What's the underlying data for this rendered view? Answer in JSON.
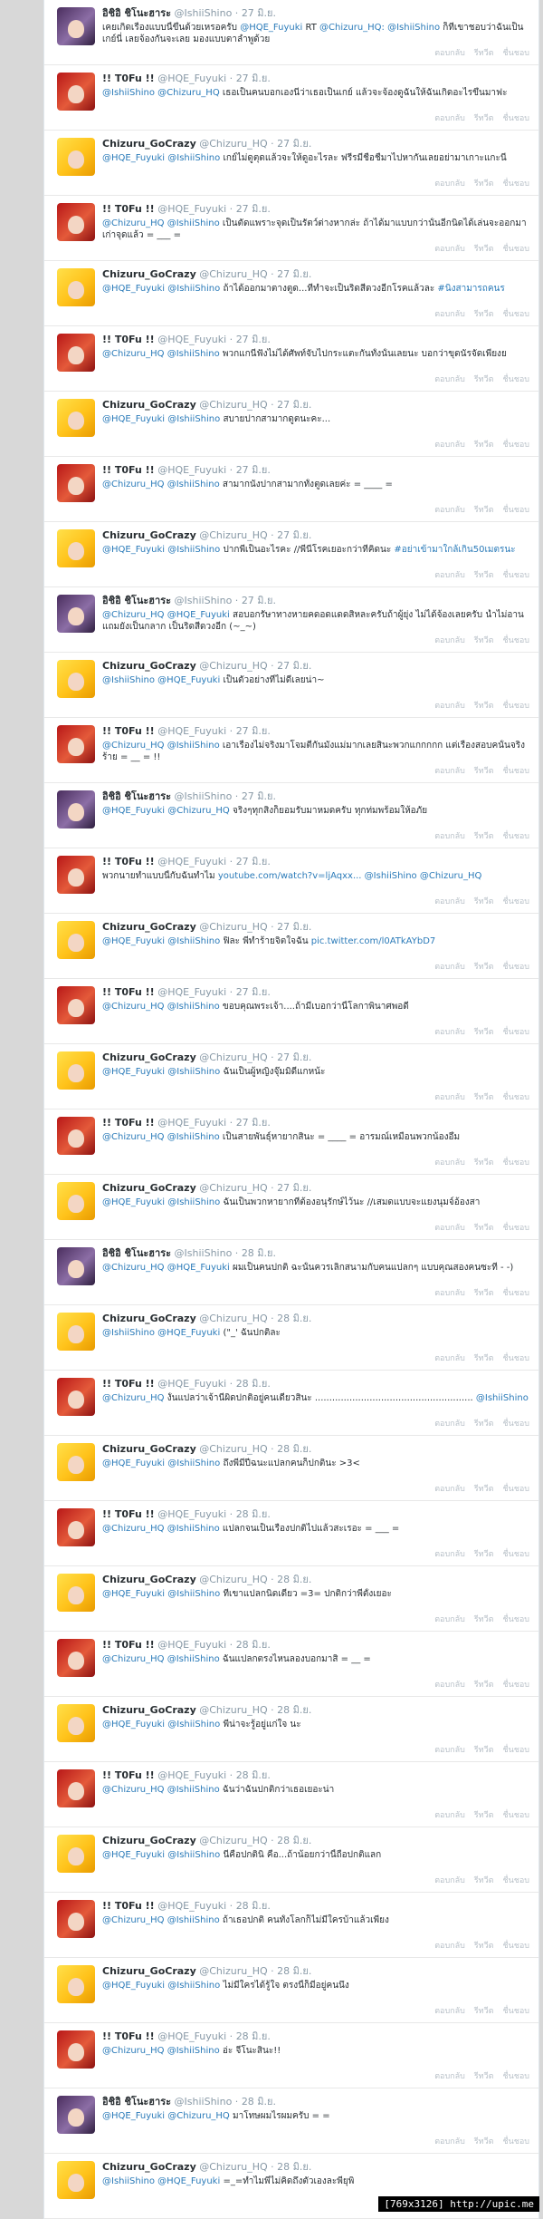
{
  "tweets": [
    {
      "avatar": "purple",
      "name": "อิชิอิ ชิโนะฮาระ",
      "handle": "@IshiiShino",
      "time": "27 มิ.ย.",
      "text": "เคยเกิดเรื่องแบบนี้ขึ้นด้วยเหรอครับ @HQE_Fuyuki RT @Chizuru_HQ: @IshiiShino ก็ที่เขาชอบว่าฉันเป็นเกย์นี่ เลยจ้องกันจะเลย มองแบบตาลำพูด้วย"
    },
    {
      "avatar": "red",
      "name": "!! T0Fu !!",
      "handle": "@HQE_Fuyuki",
      "time": "27 มิ.ย.",
      "text": "@IshiiShino @Chizuru_HQ เธอเป็นคนบอกเองนี่ว่าเธอเป็นเกย์ แล้วจะจ้องดูฉันให้ฉันเกิดอะไรขึ้นมาฟะ"
    },
    {
      "avatar": "yellow",
      "name": "Chizuru_GoCrazy",
      "handle": "@Chizuru_HQ",
      "time": "27 มิ.ย.",
      "text": "@HQE_Fuyuki @IshiiShino เกย์ไม่ดูตุดแล้วจะให้ดูอะไรละ ฟรีรมีชื่อชื่มาไปหากันเลยอย่ามาเกาะแกะนี่"
    },
    {
      "avatar": "red",
      "name": "!! T0Fu !!",
      "handle": "@HQE_Fuyuki",
      "time": "27 มิ.ย.",
      "text": "@Chizuru_HQ @IshiiShino เป็นตัดแพราะจุดเป็นรัตว์ต่างหากล่ะ ถ้าได้มาแบบกว่านั้นอีกนิดได้เล่นจะออกมาเก่าจุดแล้ว = ___ ="
    },
    {
      "avatar": "yellow",
      "name": "Chizuru_GoCrazy",
      "handle": "@Chizuru_HQ",
      "time": "27 มิ.ย.",
      "text": "@HQE_Fuyuki @IshiiShino ถ้าได้ออกมาตางตูด...ที่ทำจะเป็นริดสีดวงอีกโรคแล้วละ #นิ่งสามารถคนร"
    },
    {
      "avatar": "red",
      "name": "!! T0Fu !!",
      "handle": "@HQE_Fuyuki",
      "time": "27 มิ.ย.",
      "text": "@Chizuru_HQ @IshiiShino พวกแกนี่ฟังไม่ได้ศัพท์จับไปกระแตะกันทั้งนั้นเลยนะ บอกว่าขุดนัรจัดเพียงย"
    },
    {
      "avatar": "yellow",
      "name": "Chizuru_GoCrazy",
      "handle": "@Chizuru_HQ",
      "time": "27 มิ.ย.",
      "text": "@HQE_Fuyuki @IshiiShino สบายปากสามากดูตนะคะ..."
    },
    {
      "avatar": "red",
      "name": "!! T0Fu !!",
      "handle": "@HQE_Fuyuki",
      "time": "27 มิ.ย.",
      "text": "@Chizuru_HQ @IshiiShino สามากนังปากสามากทั้งตูดเลยค่ะ = ____ ="
    },
    {
      "avatar": "yellow",
      "name": "Chizuru_GoCrazy",
      "handle": "@Chizuru_HQ",
      "time": "27 มิ.ย.",
      "text": "@HQE_Fuyuki @IshiiShino ปากพี่เป็นอะไรคะ //พี่นี่โรคเยอะกว่าที่คิดนะ #อย่าเข้ามาใกล้เกิน50เมตรนะ"
    },
    {
      "avatar": "purple",
      "name": "อิชิอิ ชิโนะฮาระ",
      "handle": "@IshiiShino",
      "time": "27 มิ.ย.",
      "text": "@Chizuru_HQ @HQE_Fuyuki สอบอกรัษาทางหายคดอดแดดสิหละครับถ้าผู้ยุ่ง ไม่ได้จ้องเลยครับ น้ำไม่อาน แถมยังเป็นกลาก เป็นริดสีดวงอีก (~_~)"
    },
    {
      "avatar": "yellow",
      "name": "Chizuru_GoCrazy",
      "handle": "@Chizuru_HQ",
      "time": "27 มิ.ย.",
      "text": "@IshiiShino @HQE_Fuyuki เป็นตัวอย่างที่ไม่ดีเลยน่า~"
    },
    {
      "avatar": "red",
      "name": "!! T0Fu !!",
      "handle": "@HQE_Fuyuki",
      "time": "27 มิ.ย.",
      "text": "@Chizuru_HQ @IshiiShino เอาเรื่องไม่จริงมาโจมตีกันมั่งแม่มากเลยสินะพวกแกกกกก แต่เรื่องสอบคนั้นจริงร้าย = __ = !!"
    },
    {
      "avatar": "purple",
      "name": "อิชิอิ ชิโนะฮาระ",
      "handle": "@IshiiShino",
      "time": "27 มิ.ย.",
      "text": "@HQE_Fuyuki @Chizuru_HQ จริงๆทุกสิ่งก็ยอมรับมาหมดครับ ทุกท่มพร้อมให้อภัย"
    },
    {
      "avatar": "red",
      "name": "!! T0Fu !!",
      "handle": "@HQE_Fuyuki",
      "time": "27 มิ.ย.",
      "text": "พวกนายทำแบบนี้กับฉันทำไม youtube.com/watch?v=ljAqxx... @IshiiShino @Chizuru_HQ"
    },
    {
      "avatar": "yellow",
      "name": "Chizuru_GoCrazy",
      "handle": "@Chizuru_HQ",
      "time": "27 มิ.ย.",
      "text": "@HQE_Fuyuki @IshiiShino ฟิละ พี่ทำร้ายจิตใจฉัน pic.twitter.com/l0ATkAYbD7"
    },
    {
      "avatar": "red",
      "name": "!! T0Fu !!",
      "handle": "@HQE_Fuyuki",
      "time": "27 มิ.ย.",
      "text": "@Chizuru_HQ @IshiiShino ขอบคุณพระเจ้า....ถ้ามีเบอกว่านี้โลกาพินาศพอดี"
    },
    {
      "avatar": "yellow",
      "name": "Chizuru_GoCrazy",
      "handle": "@Chizuru_HQ",
      "time": "27 มิ.ย.",
      "text": "@HQE_Fuyuki @IshiiShino ฉันเป็นผู้หญิงจุ๊มมิดีแกหน้ะ"
    },
    {
      "avatar": "red",
      "name": "!! T0Fu !!",
      "handle": "@HQE_Fuyuki",
      "time": "27 มิ.ย.",
      "text": "@Chizuru_HQ @IshiiShino เป็นสายพันธุ์หายากสินะ = ____ = อารมณ์เหมือนพวกน้องอึ้ม"
    },
    {
      "avatar": "yellow",
      "name": "Chizuru_GoCrazy",
      "handle": "@Chizuru_HQ",
      "time": "27 มิ.ย.",
      "text": "@HQE_Fuyuki @IshiiShino ฉันเป็นพวกหายากที่ต้องอนุรักษ์ไว้นะ //เสมดแบบจะแยงนุมจ์อ้องสา"
    },
    {
      "avatar": "purple",
      "name": "อิชิอิ ชิโนะฮาระ",
      "handle": "@IshiiShino",
      "time": "28 มิ.ย.",
      "text": "@Chizuru_HQ @HQE_Fuyuki ผมเป็นคนปกติ ฉะนั้นควรเลิกสนามกับคนแปลกๆ แบบคุณสองคนซะที - -)"
    },
    {
      "avatar": "yellow",
      "name": "Chizuru_GoCrazy",
      "handle": "@Chizuru_HQ",
      "time": "28 มิ.ย.",
      "text": "@IshiiShino @HQE_Fuyuki (\"_' ฉันปกติละ"
    },
    {
      "avatar": "red",
      "name": "!! T0Fu !!",
      "handle": "@HQE_Fuyuki",
      "time": "28 มิ.ย.",
      "text": "@Chizuru_HQ งั้นแปลว่าเจ้านี่ผิดปกติอยู่คนเดียวสินะ ....................................................... @IshiiShino"
    },
    {
      "avatar": "yellow",
      "name": "Chizuru_GoCrazy",
      "handle": "@Chizuru_HQ",
      "time": "28 มิ.ย.",
      "text": "@HQE_Fuyuki @IshiiShino ถึงพี่มีปีฉนะแปลกคนก็ปกตินะ >3<"
    },
    {
      "avatar": "red",
      "name": "!! T0Fu !!",
      "handle": "@HQE_Fuyuki",
      "time": "28 มิ.ย.",
      "text": "@Chizuru_HQ @IshiiShino แปลกจนเป็นเรื่องปกติไปแล้วสะเรอะ = ___ ="
    },
    {
      "avatar": "yellow",
      "name": "Chizuru_GoCrazy",
      "handle": "@Chizuru_HQ",
      "time": "28 มิ.ย.",
      "text": "@HQE_Fuyuki @IshiiShino ที่เขาแปลกนิดเดียว =3= ปกติกว่าพี่ตั้งเยอะ"
    },
    {
      "avatar": "red",
      "name": "!! T0Fu !!",
      "handle": "@HQE_Fuyuki",
      "time": "28 มิ.ย.",
      "text": "@Chizuru_HQ @IshiiShino ฉันแปลกตรงไหนลองบอกมาสิ = __ ="
    },
    {
      "avatar": "yellow",
      "name": "Chizuru_GoCrazy",
      "handle": "@Chizuru_HQ",
      "time": "28 มิ.ย.",
      "text": "@HQE_Fuyuki @IshiiShino พี่น่าจะรู้อยู่แก่ใจ นะ"
    },
    {
      "avatar": "red",
      "name": "!! T0Fu !!",
      "handle": "@HQE_Fuyuki",
      "time": "28 มิ.ย.",
      "text": "@Chizuru_HQ @IshiiShino ฉันว่าฉันปกติกว่าเธอเยอะน่า"
    },
    {
      "avatar": "yellow",
      "name": "Chizuru_GoCrazy",
      "handle": "@Chizuru_HQ",
      "time": "28 มิ.ย.",
      "text": "@HQE_Fuyuki @IshiiShino นี่คือปกตินิ คือ...ถ้าน้อยกว่านี้ถือปกติแลก"
    },
    {
      "avatar": "red",
      "name": "!! T0Fu !!",
      "handle": "@HQE_Fuyuki",
      "time": "28 มิ.ย.",
      "text": "@Chizuru_HQ @IshiiShino ถ้าเธอปกติ คนทั้งโลกก็ไม่มีใครบ้าแล้วเพียง"
    },
    {
      "avatar": "yellow",
      "name": "Chizuru_GoCrazy",
      "handle": "@Chizuru_HQ",
      "time": "28 มิ.ย.",
      "text": "@HQE_Fuyuki @IshiiShino ไม่มีใครได้รู้ใจ ตรงนี้ก็มีอยู่คนนึง"
    },
    {
      "avatar": "red",
      "name": "!! T0Fu !!",
      "handle": "@HQE_Fuyuki",
      "time": "28 มิ.ย.",
      "text": "@Chizuru_HQ @IshiiShino อ่ะ จีโนะสินะ!!"
    },
    {
      "avatar": "purple",
      "name": "อิชิอิ ชิโนะฮาระ",
      "handle": "@IshiiShino",
      "time": "28 มิ.ย.",
      "text": "@HQE_Fuyuki @Chizuru_HQ มาโทษผมไรผมครับ = ="
    },
    {
      "avatar": "yellow",
      "name": "Chizuru_GoCrazy",
      "handle": "@Chizuru_HQ",
      "time": "28 มิ.ย.",
      "text": "@IshiiShino @HQE_Fuyuki =_=ทำไมพี่ไม่คิดถึงตัวเองละพี่ยุพิ"
    }
  ],
  "actions": {
    "reply": "ตอบกลับ",
    "retweet": "รีทวีต",
    "favorite": "ชื่นชอบ"
  },
  "watermark": "[769x3126] http://upic.me"
}
